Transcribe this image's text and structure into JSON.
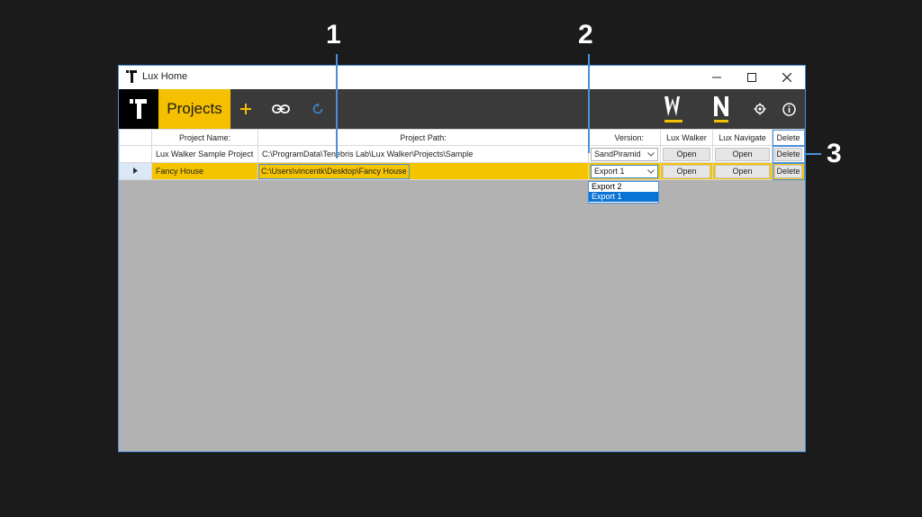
{
  "window": {
    "title": "Lux Home",
    "controls": [
      "minimize",
      "maximize",
      "close"
    ]
  },
  "toolbar": {
    "active_tab": "Projects",
    "icons": [
      "app-logo-icon",
      "add-icon",
      "link-icon",
      "refresh-icon",
      "lux-walker-icon",
      "lux-navigate-icon",
      "gear-icon",
      "info-icon"
    ]
  },
  "grid": {
    "headers": [
      "Project Name:",
      "Project Path:",
      "Version:",
      "Lux Walker",
      "Lux Navigate",
      "Delete"
    ],
    "rows": [
      {
        "name": "Lux Walker Sample Project",
        "path": "C:\\ProgramData\\Tenebris Lab\\Lux Walker\\Projects\\Sample",
        "version": "SandPiramid",
        "walker": "Open",
        "navigate": "Open",
        "delete": "Delete"
      },
      {
        "name": "Fancy House",
        "path": "C:\\Users\\vincentk\\Desktop\\Fancy House",
        "version": "Export 1",
        "walker": "Open",
        "navigate": "Open",
        "delete": "Delete"
      }
    ]
  },
  "version_dropdown": {
    "options": [
      "Export 2",
      "Export 1"
    ],
    "selected": "Export 1"
  },
  "callouts": [
    "1",
    "2",
    "3"
  ],
  "colors": {
    "accent": "#f5c000",
    "highlight": "#4a90d9",
    "toolbar": "#3a3a3a",
    "background": "#1b1b1b",
    "grid_bg": "#b2b2b2"
  }
}
